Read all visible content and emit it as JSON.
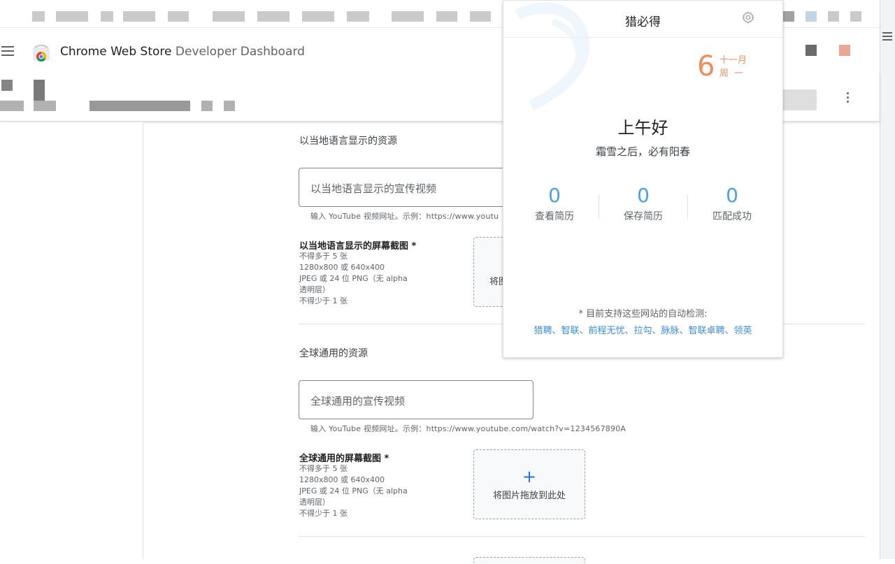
{
  "header": {
    "title_part1": "Chrome Web Store ",
    "title_part2": "Developer Dashboard"
  },
  "local_section": {
    "title": "以当地语言显示的资源",
    "video_placeholder": "以当地语言显示的宣传视频",
    "video_hint": "输入 YouTube 视频网址。示例：https://www.youtu",
    "screenshots_label": "以当地语言显示的屏幕截图 *",
    "requirements": [
      "不得多于 5 张",
      "1280x800 或 640x400",
      "JPEG 或 24 位 PNG（无 alpha",
      "透明层）",
      "不得少于 1 张"
    ],
    "dropzone_text": "将图"
  },
  "global_section": {
    "title": "全球通用的资源",
    "video_placeholder": "全球通用的宣传视频",
    "video_hint": "输入 YouTube 视频网址。示例：https://www.youtube.com/watch?v=1234567890A",
    "screenshots_label": "全球通用的屏幕截图 *",
    "requirements": [
      "不得多于 5 张",
      "1280x800 或 640x400",
      "JPEG 或 24 位 PNG（无 alpha",
      "透明层）",
      "不得少于 1 张"
    ],
    "dropzone_plus": "+",
    "dropzone_text": "将图片拖放到此处"
  },
  "popup": {
    "title": "猎必得",
    "date_day": "6",
    "date_month": "十一月",
    "date_weekday": "周一",
    "greeting": "上午好",
    "motto": "霜雪之后，必有阳春",
    "stats": [
      {
        "value": "0",
        "label": "查看简历"
      },
      {
        "value": "0",
        "label": "保存简历"
      },
      {
        "value": "0",
        "label": "匹配成功"
      }
    ],
    "support_note": "* 目前支持这些网站的自动检测:",
    "supported_sites": "猎聘、智联、前程无忧、拉勾、脉脉、智联卓聘、领英",
    "colors": {
      "accent": "#f08d5d",
      "stat": "#4aa3e0",
      "link": "#3b8de0"
    }
  }
}
